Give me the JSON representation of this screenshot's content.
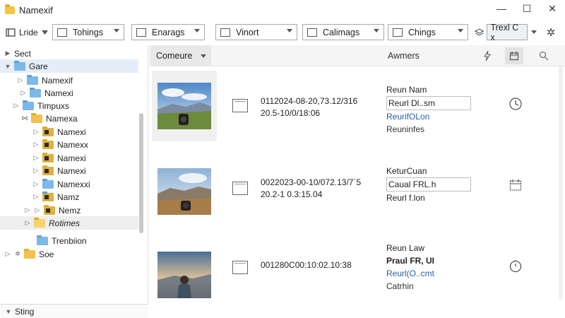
{
  "window": {
    "title": "Namexif",
    "controls": {
      "minimize": "—",
      "maximize": "☐",
      "close": "✕"
    }
  },
  "toolbar": {
    "view_label": "Lride",
    "dropdowns": [
      {
        "label": "Tohings"
      },
      {
        "label": "Enarags"
      },
      {
        "label": "Vinort"
      },
      {
        "label": "Calimags"
      },
      {
        "label": "Chings"
      }
    ],
    "search_value": "Trexl C x",
    "settings_icon": "gear-icon"
  },
  "tree": {
    "section_label": "Sect",
    "items": [
      {
        "label": "Gare"
      },
      {
        "label": "Namexif"
      },
      {
        "label": "Namexi"
      },
      {
        "label": "Timpuxs"
      },
      {
        "label": "Namexa"
      },
      {
        "label": "Namexi"
      },
      {
        "label": "Namexx"
      },
      {
        "label": "Namexi"
      },
      {
        "label": "Namexi"
      },
      {
        "label": "Namexxi"
      },
      {
        "label": "Namz"
      },
      {
        "label": "Nemz"
      },
      {
        "label": "Rotimes"
      },
      {
        "label": "Trenbiion"
      },
      {
        "label": "Soe"
      }
    ],
    "footer_label": "Sting"
  },
  "list": {
    "sort_label": "Comeure",
    "column_label": "Awmers",
    "rows": [
      {
        "meta_line1": "0112024-08-20,73.12/316",
        "meta_line2": "20.5-10/0/18:06",
        "info1": "Reun Nam",
        "info2": "Reurl Dl..sm",
        "info3": "ReurifOLon",
        "info4": "Reuninfes",
        "icon": "clock-icon"
      },
      {
        "meta_line1": "0022023-00-10/072.13/7´5",
        "meta_line2": "20.2-1 0.3:15.04",
        "info1": "KeturCuan",
        "info2": "Caual FRL.h",
        "info3": "Reurl f.lon",
        "info4": "",
        "icon": "calendar-icon"
      },
      {
        "meta_line1": "001280C00:10:02.10:38",
        "meta_line2": "",
        "info1": "Reun Law",
        "info2": "Praul FR, UI",
        "info3": "Reurl(O..cmt",
        "info4": "Catrhin",
        "icon": "timer-icon"
      }
    ]
  },
  "colors": {
    "folder": "#f2c14e",
    "folder_blue": "#7cb9e8",
    "selection": "#e5eef8",
    "link": "#2760a8"
  }
}
